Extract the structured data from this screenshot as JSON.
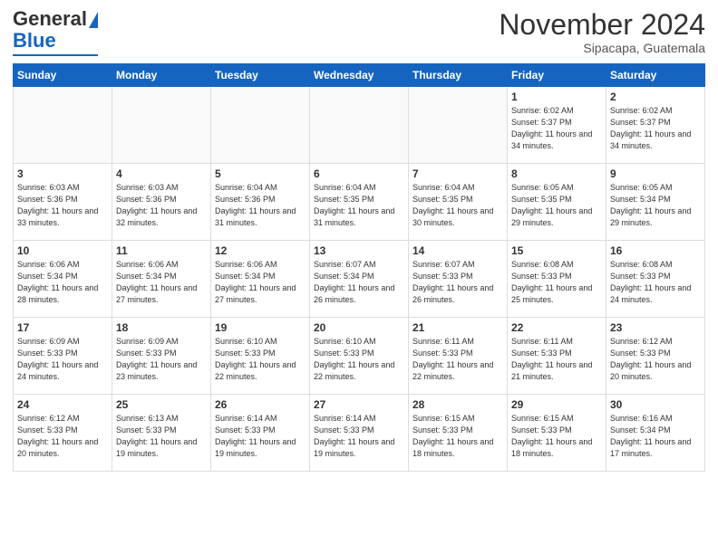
{
  "logo": {
    "general": "General",
    "blue": "Blue"
  },
  "header": {
    "month": "November 2024",
    "location": "Sipacapa, Guatemala"
  },
  "weekdays": [
    "Sunday",
    "Monday",
    "Tuesday",
    "Wednesday",
    "Thursday",
    "Friday",
    "Saturday"
  ],
  "weeks": [
    [
      {
        "day": null
      },
      {
        "day": null
      },
      {
        "day": null
      },
      {
        "day": null
      },
      {
        "day": null
      },
      {
        "day": 1,
        "sunrise": "Sunrise: 6:02 AM",
        "sunset": "Sunset: 5:37 PM",
        "daylight": "Daylight: 11 hours and 34 minutes."
      },
      {
        "day": 2,
        "sunrise": "Sunrise: 6:02 AM",
        "sunset": "Sunset: 5:37 PM",
        "daylight": "Daylight: 11 hours and 34 minutes."
      }
    ],
    [
      {
        "day": 3,
        "sunrise": "Sunrise: 6:03 AM",
        "sunset": "Sunset: 5:36 PM",
        "daylight": "Daylight: 11 hours and 33 minutes."
      },
      {
        "day": 4,
        "sunrise": "Sunrise: 6:03 AM",
        "sunset": "Sunset: 5:36 PM",
        "daylight": "Daylight: 11 hours and 32 minutes."
      },
      {
        "day": 5,
        "sunrise": "Sunrise: 6:04 AM",
        "sunset": "Sunset: 5:36 PM",
        "daylight": "Daylight: 11 hours and 31 minutes."
      },
      {
        "day": 6,
        "sunrise": "Sunrise: 6:04 AM",
        "sunset": "Sunset: 5:35 PM",
        "daylight": "Daylight: 11 hours and 31 minutes."
      },
      {
        "day": 7,
        "sunrise": "Sunrise: 6:04 AM",
        "sunset": "Sunset: 5:35 PM",
        "daylight": "Daylight: 11 hours and 30 minutes."
      },
      {
        "day": 8,
        "sunrise": "Sunrise: 6:05 AM",
        "sunset": "Sunset: 5:35 PM",
        "daylight": "Daylight: 11 hours and 29 minutes."
      },
      {
        "day": 9,
        "sunrise": "Sunrise: 6:05 AM",
        "sunset": "Sunset: 5:34 PM",
        "daylight": "Daylight: 11 hours and 29 minutes."
      }
    ],
    [
      {
        "day": 10,
        "sunrise": "Sunrise: 6:06 AM",
        "sunset": "Sunset: 5:34 PM",
        "daylight": "Daylight: 11 hours and 28 minutes."
      },
      {
        "day": 11,
        "sunrise": "Sunrise: 6:06 AM",
        "sunset": "Sunset: 5:34 PM",
        "daylight": "Daylight: 11 hours and 27 minutes."
      },
      {
        "day": 12,
        "sunrise": "Sunrise: 6:06 AM",
        "sunset": "Sunset: 5:34 PM",
        "daylight": "Daylight: 11 hours and 27 minutes."
      },
      {
        "day": 13,
        "sunrise": "Sunrise: 6:07 AM",
        "sunset": "Sunset: 5:34 PM",
        "daylight": "Daylight: 11 hours and 26 minutes."
      },
      {
        "day": 14,
        "sunrise": "Sunrise: 6:07 AM",
        "sunset": "Sunset: 5:33 PM",
        "daylight": "Daylight: 11 hours and 26 minutes."
      },
      {
        "day": 15,
        "sunrise": "Sunrise: 6:08 AM",
        "sunset": "Sunset: 5:33 PM",
        "daylight": "Daylight: 11 hours and 25 minutes."
      },
      {
        "day": 16,
        "sunrise": "Sunrise: 6:08 AM",
        "sunset": "Sunset: 5:33 PM",
        "daylight": "Daylight: 11 hours and 24 minutes."
      }
    ],
    [
      {
        "day": 17,
        "sunrise": "Sunrise: 6:09 AM",
        "sunset": "Sunset: 5:33 PM",
        "daylight": "Daylight: 11 hours and 24 minutes."
      },
      {
        "day": 18,
        "sunrise": "Sunrise: 6:09 AM",
        "sunset": "Sunset: 5:33 PM",
        "daylight": "Daylight: 11 hours and 23 minutes."
      },
      {
        "day": 19,
        "sunrise": "Sunrise: 6:10 AM",
        "sunset": "Sunset: 5:33 PM",
        "daylight": "Daylight: 11 hours and 22 minutes."
      },
      {
        "day": 20,
        "sunrise": "Sunrise: 6:10 AM",
        "sunset": "Sunset: 5:33 PM",
        "daylight": "Daylight: 11 hours and 22 minutes."
      },
      {
        "day": 21,
        "sunrise": "Sunrise: 6:11 AM",
        "sunset": "Sunset: 5:33 PM",
        "daylight": "Daylight: 11 hours and 22 minutes."
      },
      {
        "day": 22,
        "sunrise": "Sunrise: 6:11 AM",
        "sunset": "Sunset: 5:33 PM",
        "daylight": "Daylight: 11 hours and 21 minutes."
      },
      {
        "day": 23,
        "sunrise": "Sunrise: 6:12 AM",
        "sunset": "Sunset: 5:33 PM",
        "daylight": "Daylight: 11 hours and 20 minutes."
      }
    ],
    [
      {
        "day": 24,
        "sunrise": "Sunrise: 6:12 AM",
        "sunset": "Sunset: 5:33 PM",
        "daylight": "Daylight: 11 hours and 20 minutes."
      },
      {
        "day": 25,
        "sunrise": "Sunrise: 6:13 AM",
        "sunset": "Sunset: 5:33 PM",
        "daylight": "Daylight: 11 hours and 19 minutes."
      },
      {
        "day": 26,
        "sunrise": "Sunrise: 6:14 AM",
        "sunset": "Sunset: 5:33 PM",
        "daylight": "Daylight: 11 hours and 19 minutes."
      },
      {
        "day": 27,
        "sunrise": "Sunrise: 6:14 AM",
        "sunset": "Sunset: 5:33 PM",
        "daylight": "Daylight: 11 hours and 19 minutes."
      },
      {
        "day": 28,
        "sunrise": "Sunrise: 6:15 AM",
        "sunset": "Sunset: 5:33 PM",
        "daylight": "Daylight: 11 hours and 18 minutes."
      },
      {
        "day": 29,
        "sunrise": "Sunrise: 6:15 AM",
        "sunset": "Sunset: 5:33 PM",
        "daylight": "Daylight: 11 hours and 18 minutes."
      },
      {
        "day": 30,
        "sunrise": "Sunrise: 6:16 AM",
        "sunset": "Sunset: 5:34 PM",
        "daylight": "Daylight: 11 hours and 17 minutes."
      }
    ]
  ]
}
